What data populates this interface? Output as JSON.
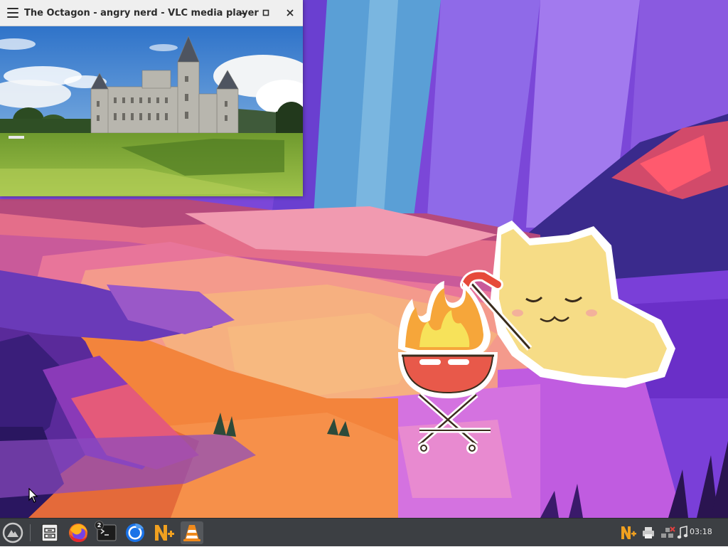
{
  "window": {
    "title": "The Octagon - angry nerd - VLC media player",
    "video_scene": "castle-on-lawn"
  },
  "taskbar": {
    "items": [
      {
        "name": "start-menu",
        "icon": "distro-logo-icon"
      },
      {
        "name": "file-manager",
        "icon": "file-manager-icon"
      },
      {
        "name": "firefox",
        "icon": "firefox-icon"
      },
      {
        "name": "terminal",
        "icon": "terminal-icon",
        "badge": "2"
      },
      {
        "name": "chromium",
        "icon": "chromium-icon"
      },
      {
        "name": "app-n",
        "icon": "n-plus-icon"
      },
      {
        "name": "vlc",
        "icon": "vlc-cone-icon"
      }
    ],
    "tray": {
      "icons": [
        "n-plus-tray-icon",
        "printer-icon",
        "network-disconnected-icon",
        "music-note-icon"
      ],
      "clock": "03:18"
    }
  },
  "colors": {
    "titlebar": "#efefef",
    "taskbar": "#3c3f43",
    "vlc_orange": "#f08a1c",
    "accent_yellow": "#f7c948"
  }
}
